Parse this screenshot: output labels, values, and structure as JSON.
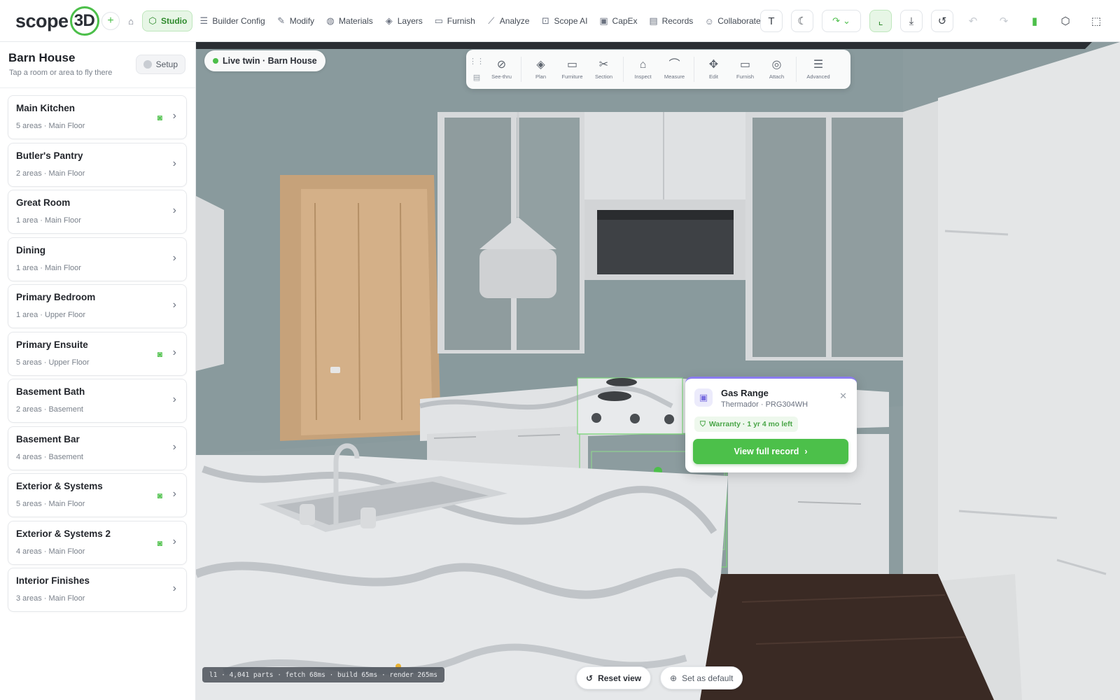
{
  "app": {
    "logo_text": "scope",
    "logo_mark": "3D",
    "nav": [
      {
        "label": "Studio",
        "icon": "studio-icon",
        "active": true
      },
      {
        "label": "Builder Config",
        "icon": "sliders-icon"
      },
      {
        "label": "Modify",
        "icon": "brush-icon"
      },
      {
        "label": "Materials",
        "icon": "palette-icon"
      },
      {
        "label": "Layers",
        "icon": "layers-icon"
      },
      {
        "label": "Furnish",
        "icon": "sofa-icon"
      },
      {
        "label": "Analyze",
        "icon": "ruler-icon"
      },
      {
        "label": "Scope AI",
        "icon": "robot-icon"
      },
      {
        "label": "CapEx",
        "icon": "wallet-icon"
      },
      {
        "label": "Records",
        "icon": "clipboard-icon"
      },
      {
        "label": "Collaborate",
        "icon": "users-icon"
      }
    ],
    "right_tools": [
      "text-icon",
      "moon-icon",
      "curve-icon",
      "axis-icon",
      "download-icon",
      "history-icon",
      "undo-icon",
      "redo-icon",
      "bookmark-icon",
      "cube-icon",
      "fullscreen-icon"
    ]
  },
  "sidebar": {
    "title": "Barn House",
    "subtitle": "Tap a room or area to fly there",
    "setup_label": "Setup",
    "rooms": [
      {
        "name": "Main Kitchen",
        "meta": "5 areas · Main Floor",
        "camera": true
      },
      {
        "name": "Butler's Pantry",
        "meta": "2 areas · Main Floor",
        "camera": false
      },
      {
        "name": "Great Room",
        "meta": "1 area · Main Floor",
        "camera": false
      },
      {
        "name": "Dining",
        "meta": "1 area · Main Floor",
        "camera": false
      },
      {
        "name": "Primary Bedroom",
        "meta": "1 area · Upper Floor",
        "camera": false
      },
      {
        "name": "Primary Ensuite",
        "meta": "5 areas · Upper Floor",
        "camera": true
      },
      {
        "name": "Basement Bath",
        "meta": "2 areas · Basement",
        "camera": false
      },
      {
        "name": "Basement Bar",
        "meta": "4 areas · Basement",
        "camera": false
      },
      {
        "name": "Exterior & Systems",
        "meta": "5 areas · Main Floor",
        "camera": true
      },
      {
        "name": "Exterior & Systems 2",
        "meta": "4 areas · Main Floor",
        "camera": true
      },
      {
        "name": "Interior Finishes",
        "meta": "3 areas · Main Floor",
        "camera": false
      }
    ]
  },
  "viewport": {
    "live_label": "Live twin · Barn House",
    "toolbar": [
      {
        "label": "See-thru",
        "icon": "eye-off-icon"
      },
      {
        "label": "Plan",
        "icon": "layers-icon"
      },
      {
        "label": "Furniture",
        "icon": "sofa-icon"
      },
      {
        "label": "Section",
        "icon": "scissors-icon"
      },
      {
        "label": "Inspect",
        "icon": "tag-icon"
      },
      {
        "label": "Measure",
        "icon": "measure-icon"
      },
      {
        "label": "Edit",
        "icon": "move-icon"
      },
      {
        "label": "Furnish",
        "icon": "sofa-icon"
      },
      {
        "label": "Attach",
        "icon": "target-icon"
      },
      {
        "label": "Advanced",
        "icon": "sliders-icon"
      }
    ],
    "popup": {
      "title": "Gas Range",
      "subtitle": "Thermador · PRG304WH",
      "warranty": "Warranty · 1 yr 4 mo left",
      "cta": "View full record"
    },
    "reset_label": "Reset view",
    "default_label": "Set as default",
    "status": "l1 · 4,041 parts · fetch 68ms · build 65ms · render 265ms"
  },
  "colors": {
    "accent": "#4cbf4a",
    "accent_soft": "#e7f6e6",
    "popup_accent": "#8b7cf0"
  }
}
